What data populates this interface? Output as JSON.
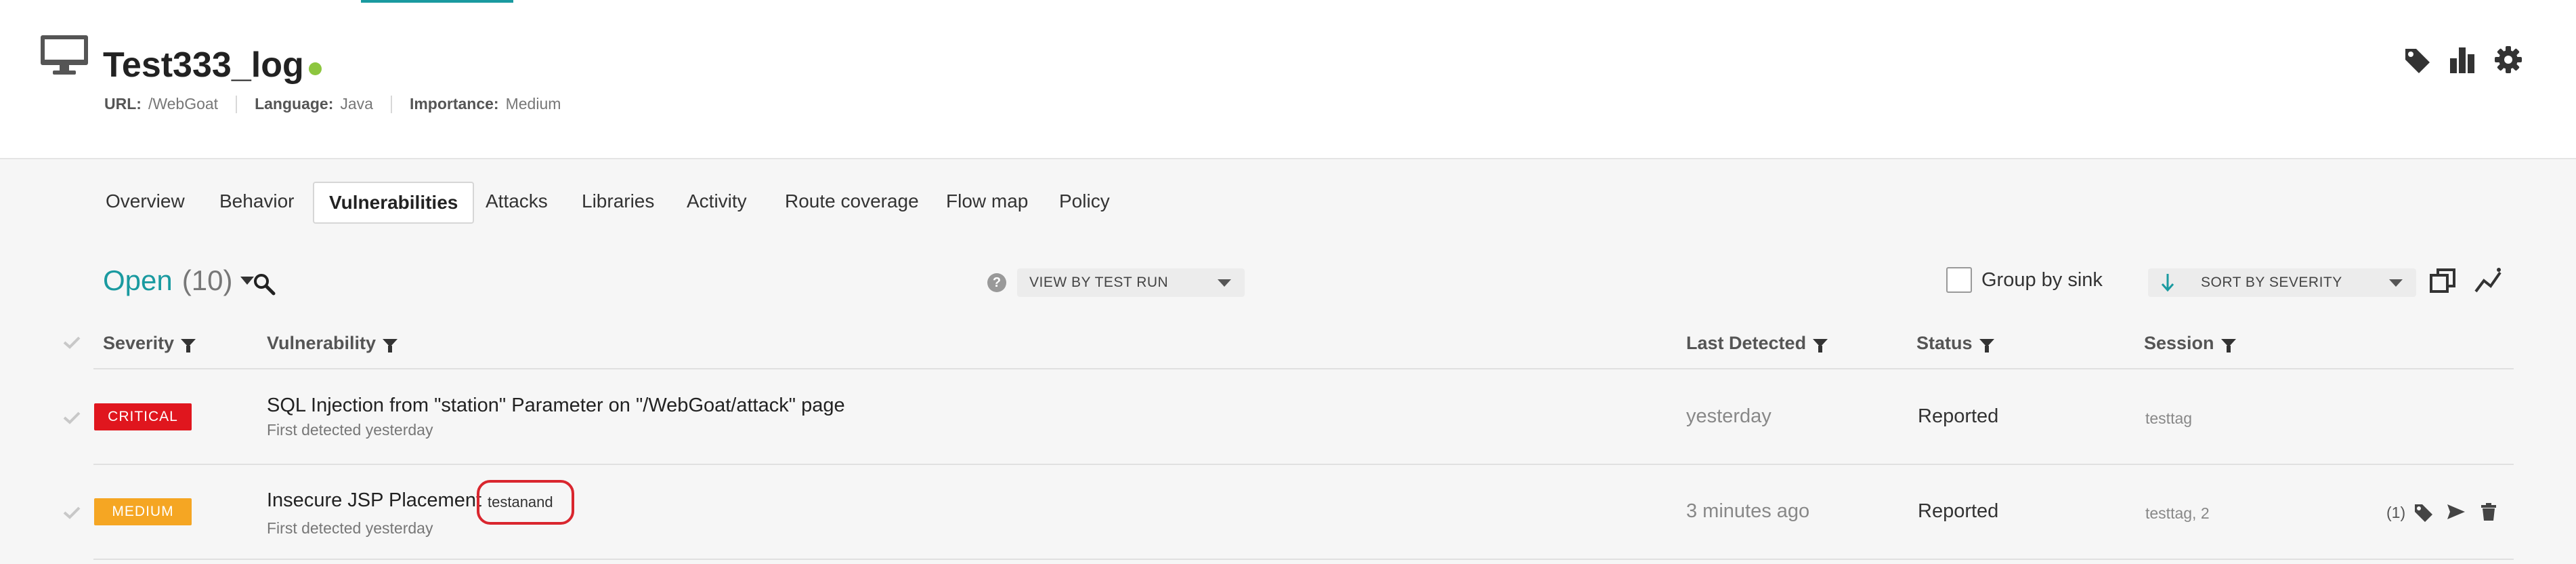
{
  "app": {
    "title": "Test333_log",
    "status_color": "#8dc63f",
    "meta": [
      {
        "key": "URL:",
        "value": "/WebGoat"
      },
      {
        "key": "Language:",
        "value": "Java"
      },
      {
        "key": "Importance:",
        "value": "Medium"
      }
    ],
    "header_icons": [
      "tag-icon",
      "bar-chart-icon",
      "gear-icon"
    ]
  },
  "tabs": [
    {
      "label": "Overview",
      "active": false
    },
    {
      "label": "Behavior",
      "active": false
    },
    {
      "label": "Vulnerabilities",
      "active": true
    },
    {
      "label": "Attacks",
      "active": false
    },
    {
      "label": "Libraries",
      "active": false
    },
    {
      "label": "Activity",
      "active": false
    },
    {
      "label": "Route coverage",
      "active": false
    },
    {
      "label": "Flow map",
      "active": false
    },
    {
      "label": "Policy",
      "active": false
    }
  ],
  "toolbar": {
    "status_filter": "Open",
    "count": "(10)",
    "view_select": "VIEW BY TEST RUN",
    "group_by_sink": "Group by sink",
    "group_by_sink_checked": false,
    "sort_select": "SORT BY SEVERITY",
    "accent_color": "#1a9aa0"
  },
  "table": {
    "columns": {
      "severity": "Severity",
      "vulnerability": "Vulnerability",
      "last_detected": "Last Detected",
      "status": "Status",
      "session": "Session"
    },
    "rows": [
      {
        "severity": "CRITICAL",
        "severity_color": "#e0161e",
        "title": "SQL Injection from \"station\" Parameter on \"/WebGoat/attack\" page",
        "subtitle": "First detected yesterday",
        "tag": "",
        "last_detected": "yesterday",
        "status": "Reported",
        "session": "testtag",
        "count": ""
      },
      {
        "severity": "MEDIUM",
        "severity_color": "#f5a623",
        "title": "Insecure JSP Placement",
        "subtitle": "First detected yesterday",
        "tag": "testanand",
        "last_detected": "3 minutes ago",
        "status": "Reported",
        "session": "testtag, 2",
        "count": "(1)"
      }
    ]
  }
}
